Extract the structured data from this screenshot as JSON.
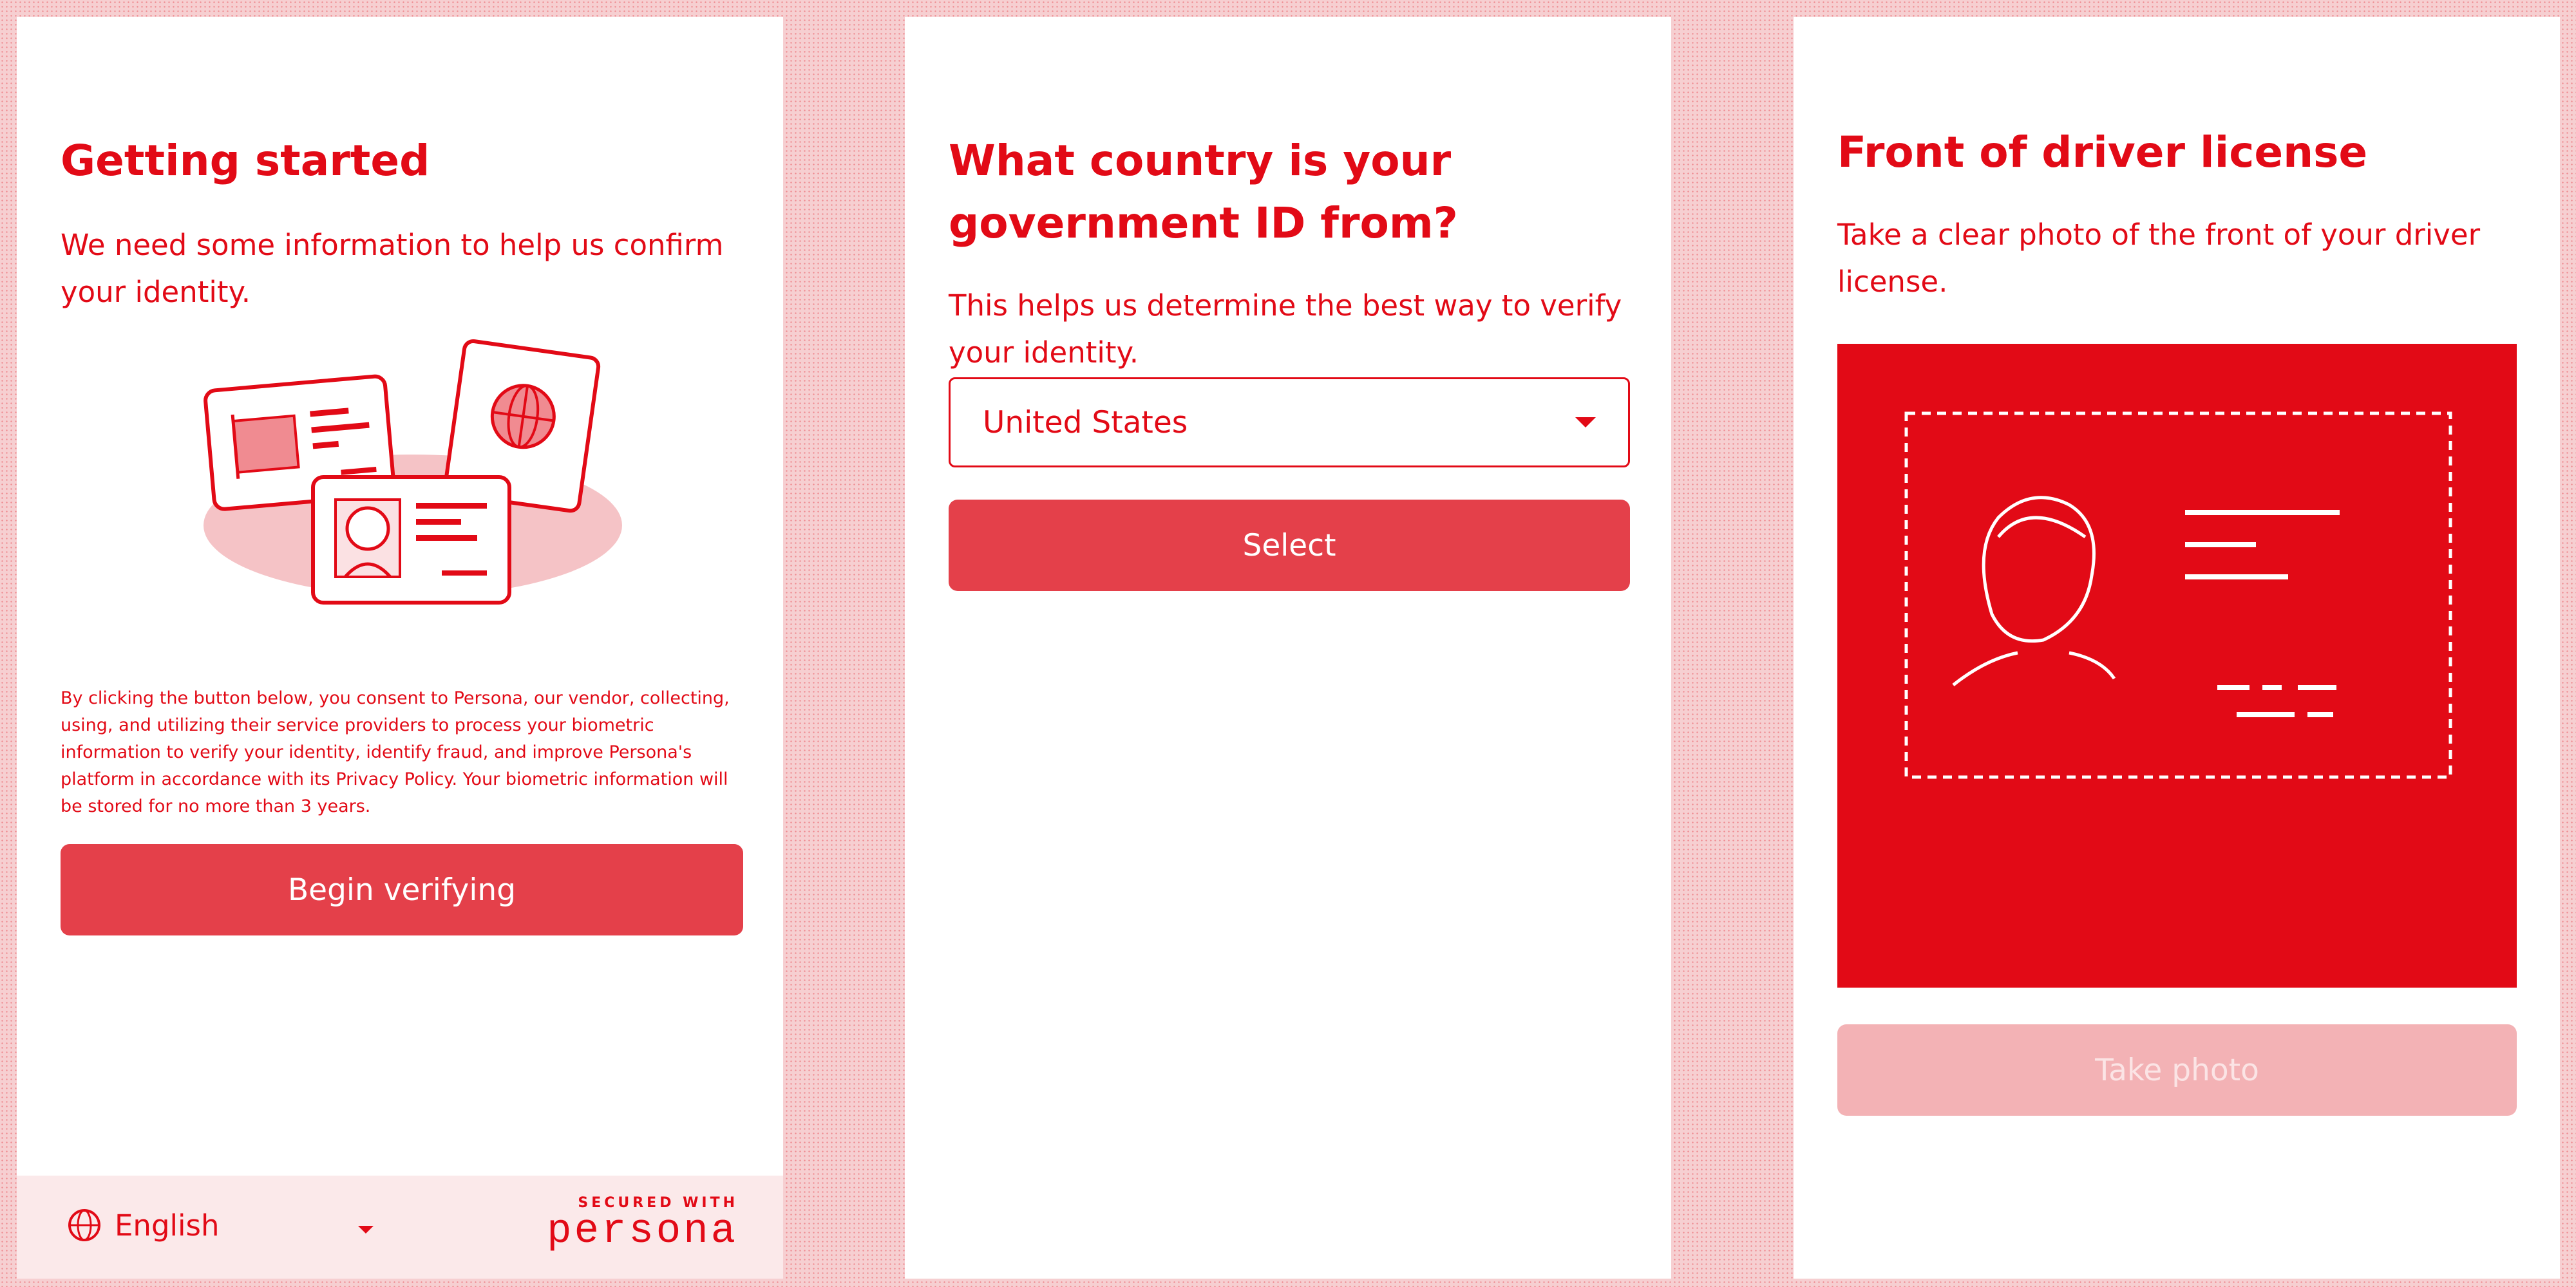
{
  "colors": {
    "accent": "#e20a16",
    "button": "#e4404a",
    "button_disabled": "#f3b2b5"
  },
  "panel1": {
    "title": "Getting started",
    "subtitle": "We need some information to help us confirm your identity.",
    "illustration_icon": "id-documents-icon",
    "consent": "By clicking the button below, you consent to Persona, our vendor, collecting, using, and utilizing their service providers to process your biometric information to verify your identity, identify fraud, and improve Persona's platform in accordance with its Privacy Policy. Your biometric information will be stored for no more than 3 years.",
    "button_label": "Begin verifying",
    "footer": {
      "language": "English",
      "language_icon": "globe-icon",
      "secured_tag": "SECURED WITH",
      "brand": "persona"
    }
  },
  "panel2": {
    "title": "What country is your government ID from?",
    "subtitle": "This helps us determine the best way to verify your identity.",
    "country_selected": "United States",
    "button_label": "Select"
  },
  "panel3": {
    "title": "Front of driver license",
    "subtitle": "Take a clear photo of the front of your driver license.",
    "camera_icon": "driver-license-guide-icon",
    "button_label": "Take photo"
  }
}
